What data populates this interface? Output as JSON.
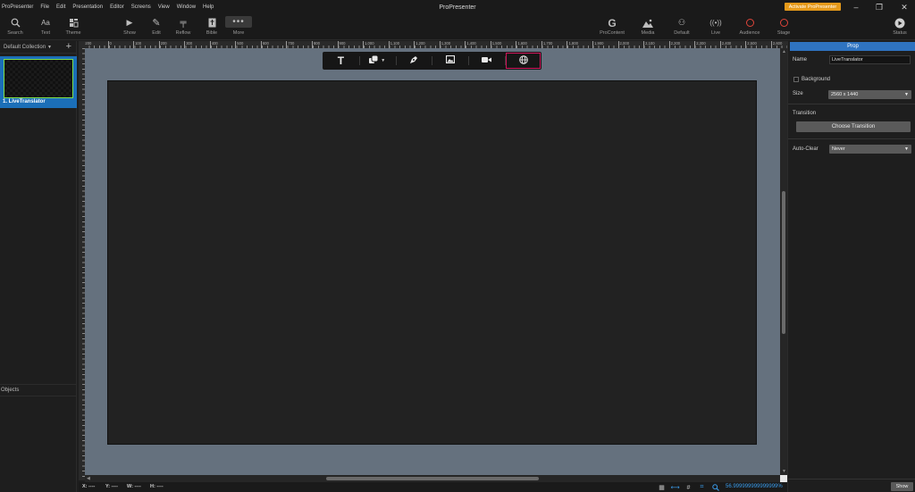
{
  "menubar": {
    "items": [
      "ProPresenter",
      "File",
      "Edit",
      "Presentation",
      "Editor",
      "Screens",
      "View",
      "Window",
      "Help"
    ],
    "title": "ProPresenter",
    "activate_label": "Activate ProPresenter",
    "window_controls": [
      "minimize-icon",
      "restore-icon",
      "close-icon"
    ]
  },
  "toolbar": {
    "left_tools": [
      {
        "label": "Search",
        "icon": "search-icon"
      },
      {
        "label": "Text",
        "icon": "text-icon"
      },
      {
        "label": "Theme",
        "icon": "theme-icon"
      },
      {
        "label": "Show",
        "icon": "play-icon"
      },
      {
        "label": "Edit",
        "icon": "pencil-icon"
      },
      {
        "label": "Reflow",
        "icon": "reflow-icon"
      },
      {
        "label": "Bible",
        "icon": "bible-icon"
      },
      {
        "label": "More",
        "icon": "more-icon"
      }
    ],
    "right_tools": [
      {
        "label": "ProContent",
        "icon": "procontent-icon"
      },
      {
        "label": "Media",
        "icon": "media-icon"
      },
      {
        "label": "Default",
        "icon": "default-icon"
      },
      {
        "label": "Live",
        "icon": "live-broadcast-icon"
      },
      {
        "label": "Audience",
        "icon": "audience-ring-icon"
      },
      {
        "label": "Stage",
        "icon": "stage-ring-icon"
      },
      {
        "label": "Status",
        "icon": "status-icon"
      }
    ]
  },
  "left_panel": {
    "collection_label": "Default Collection",
    "slide": {
      "label": "1.  LiveTranslator"
    },
    "objects_label": "Objects"
  },
  "ruler": {
    "top_labels": [
      "-200",
      "0",
      "100",
      "200",
      "300",
      "400",
      "500",
      "600",
      "700",
      "800",
      "900",
      "1,000",
      "1,100",
      "1,200",
      "1,300",
      "1,400",
      "1,500",
      "1,600",
      "1,700",
      "1,800",
      "1,900",
      "2,000",
      "2,100",
      "2,200",
      "2,300",
      "2,400",
      "2,500",
      "2,600"
    ]
  },
  "object_toolbar": {
    "buttons": [
      {
        "name": "text-tool-icon",
        "glyph": "T"
      },
      {
        "name": "shape-tool-icon",
        "glyph": "■"
      },
      {
        "name": "pen-tool-icon",
        "glyph": "✒"
      },
      {
        "name": "image-tool-icon",
        "glyph": "▣"
      },
      {
        "name": "video-tool-icon",
        "glyph": "■"
      },
      {
        "name": "web-tool-icon",
        "glyph": "⊕"
      }
    ],
    "selected": "web-tool-icon"
  },
  "statusbar": {
    "x_label": "X: ----",
    "y_label": "Y: ----",
    "w_label": "W: ----",
    "h_label": "H: ----",
    "zoom": "56.999999999999999%"
  },
  "properties": {
    "tab_label": "Prop",
    "name_label": "Name",
    "name_value": "LiveTranslator",
    "background_label": "Background",
    "size_label": "Size",
    "size_value": "2560 x 1440",
    "transition_label": "Transition",
    "choose_transition_label": "Choose Transition",
    "auto_clear_label": "Auto-Clear",
    "auto_clear_value": "Never",
    "show_label": "Show"
  },
  "colors": {
    "accent_blue": "#2f73c0",
    "activate_orange": "#e69a1a",
    "selected_outline": "#d0145a",
    "thumb_border": "#7fe04a",
    "canvas_bg": "#65717e"
  }
}
